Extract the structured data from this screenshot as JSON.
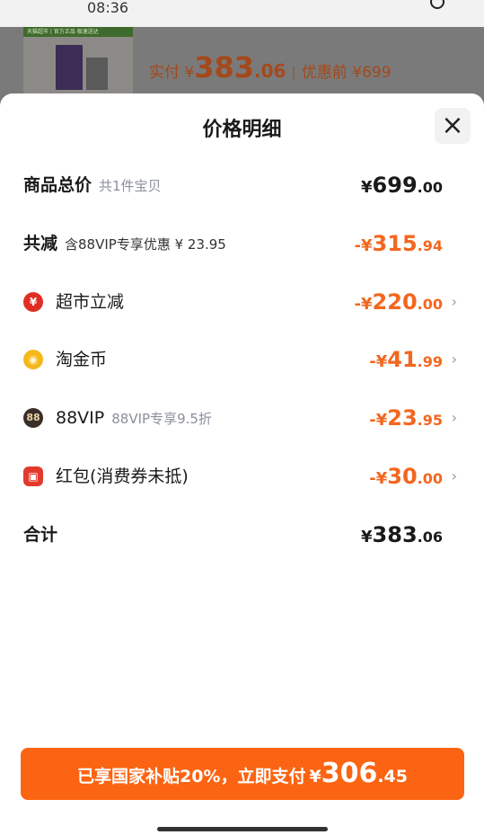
{
  "status": {
    "time": "08:36"
  },
  "background_order": {
    "banner_text": "天猫超市 | 官方正品 极速送达",
    "paid_label": "实付 ¥ ",
    "paid_int": "383",
    "paid_dec": ".06",
    "separator": "|",
    "before_label": "优惠前 ¥699"
  },
  "sheet": {
    "title": "价格明细",
    "close_glyph": "×"
  },
  "rows": [
    {
      "label": "商品总价",
      "sub": "共1件宝贝",
      "prefix": "¥",
      "int": "699",
      "dec": ".00"
    },
    {
      "label": "共减",
      "sub": "含88VIP专享优惠 ¥ 23.95",
      "prefix": "-¥",
      "int": "315",
      "dec": ".94"
    },
    {
      "icon": "supermarket-discount-icon",
      "icon_glyph": "¥",
      "label": "超市立减",
      "prefix": "-¥",
      "int": "220",
      "dec": ".00",
      "chevron": "›"
    },
    {
      "icon": "taojinbi-coin-icon",
      "icon_glyph": "◉",
      "label": "淘金币",
      "prefix": "-¥",
      "int": "41",
      "dec": ".99",
      "chevron": "›"
    },
    {
      "icon": "88vip-icon",
      "icon_glyph": "88",
      "label": "88VIP",
      "sub": "88VIP专享9.5折",
      "prefix": "-¥",
      "int": "23",
      "dec": ".95",
      "chevron": "›"
    },
    {
      "icon": "red-packet-icon",
      "icon_glyph": "▣",
      "label": "红包(消费券未抵)",
      "prefix": "-¥",
      "int": "30",
      "dec": ".00",
      "chevron": "›"
    },
    {
      "label": "合计",
      "prefix": "¥",
      "int": "383",
      "dec": ".06"
    }
  ],
  "pay_button": {
    "text": "已享国家补贴20%，立即支付",
    "prefix": "¥",
    "int": "306",
    "dec": ".45"
  },
  "colors": {
    "accent_orange": "#fb6412",
    "discount_orange": "#f2671f"
  }
}
